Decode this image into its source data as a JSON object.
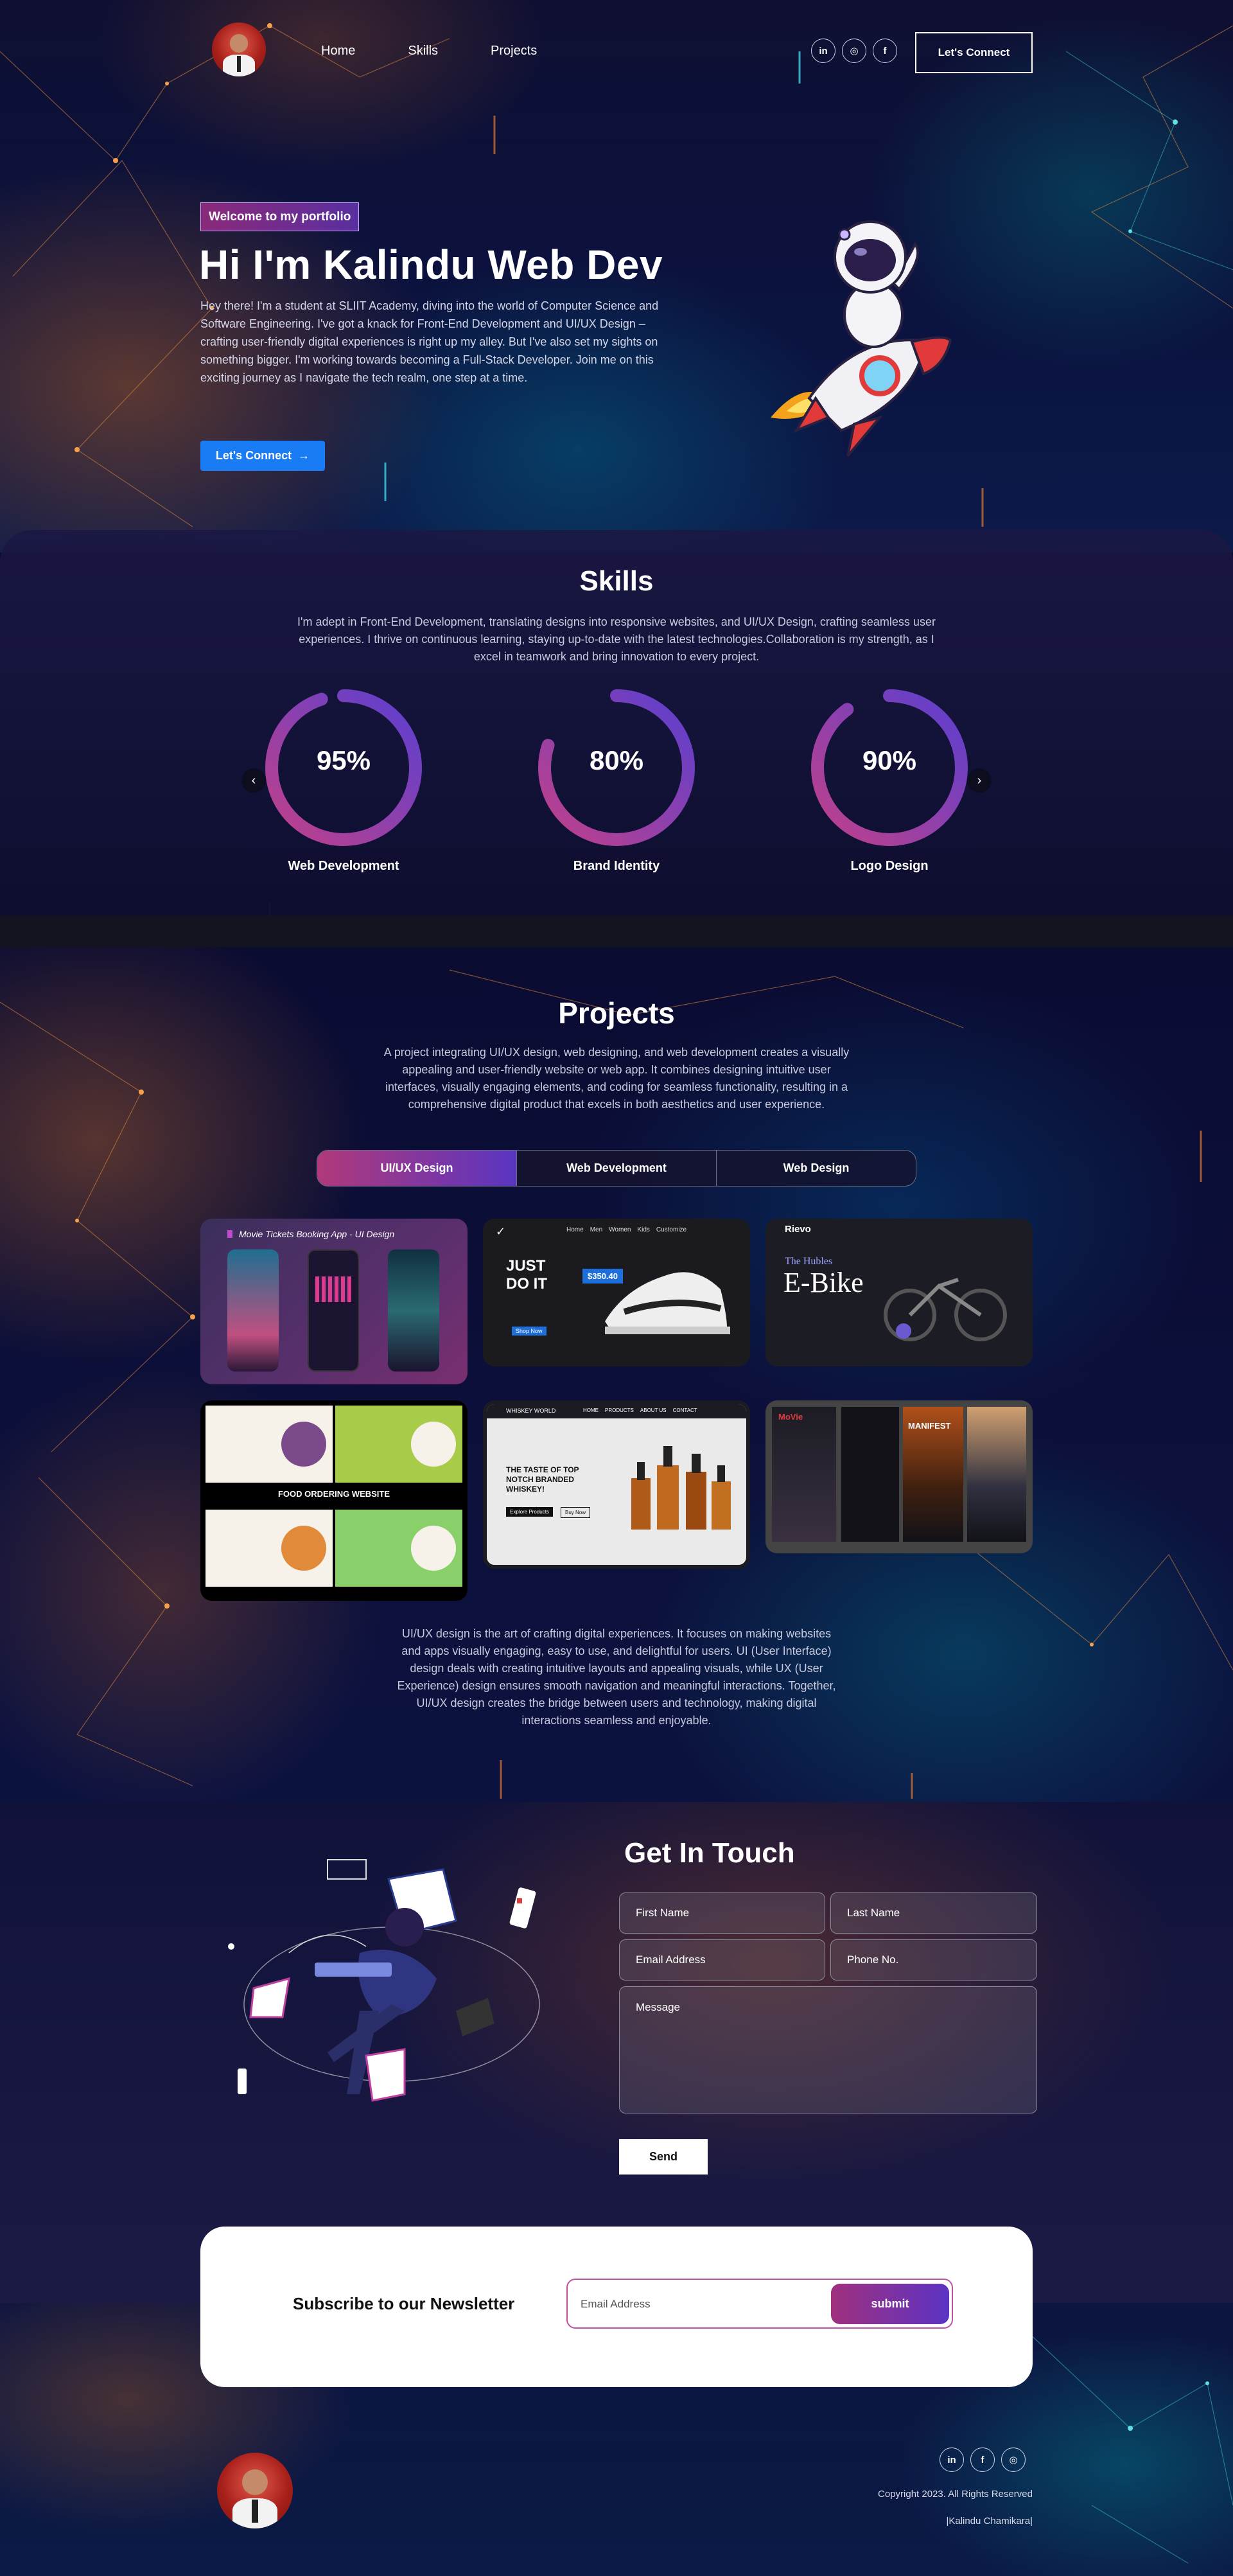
{
  "nav": {
    "links": [
      "Home",
      "Skills",
      "Projects"
    ],
    "social_icons": [
      "linkedin-icon",
      "instagram-icon",
      "facebook-icon"
    ],
    "social_glyphs": [
      "in",
      "◎",
      "f"
    ],
    "cta": "Let's Connect"
  },
  "hero": {
    "badge": "Welcome to my portfolio",
    "title": "Hi I'm Kalindu Web Dev",
    "text": "Hey there! I'm a student at SLIIT Academy, diving into the world of Computer Science and Software Engineering. I've got a knack for Front-End Development and UI/UX Design – crafting user-friendly digital experiences is right up my alley. But I've also set my sights on something bigger. I'm working towards becoming a Full-Stack Developer. Join me on this exciting journey as I navigate the tech realm, one step at a time.",
    "button": "Let's Connect"
  },
  "skills": {
    "title": "Skills",
    "text": "I'm adept in Front-End Development, translating designs into responsive websites, and UI/UX Design, crafting seamless user experiences. I thrive on continuous learning, staying up-to-date with the latest technologies.Collaboration is my strength, as I excel in teamwork and bring innovation to every project.",
    "items": [
      {
        "label": "Web Development",
        "value_text": "95%",
        "value": 95
      },
      {
        "label": "Brand Identity",
        "value_text": "80%",
        "value": 80
      },
      {
        "label": "Logo Design",
        "value_text": "90%",
        "value": 90
      }
    ]
  },
  "projects": {
    "title": "Projects",
    "text": "A project integrating UI/UX design, web designing, and web development creates a visually appealing and user-friendly website or web app. It combines designing intuitive user interfaces, visually engaging elements, and coding for seamless functionality, resulting in a comprehensive digital product that excels in both aesthetics and user experience.",
    "tabs": [
      "UI/UX Design",
      "Web Development",
      "Web Design"
    ],
    "active_tab": 0,
    "cards": {
      "movie": "Movie Tickets Booking App - UI Design",
      "nike_headline": "JUST DO IT",
      "nike_price": "$350.40",
      "nike_nav": [
        "Home",
        "Men",
        "Women",
        "Kids",
        "Customize"
      ],
      "nike_btn": "Shop Now",
      "ebike_brand": "Rievo",
      "ebike_sub": "The Hubles",
      "ebike_title": "E-Bike",
      "food_banner": "FOOD ORDERING WEBSITE",
      "whiskey_brand": "WHISKEY WORLD",
      "whiskey_nav": [
        "HOME",
        "PRODUCTS",
        "ABOUT US",
        "CONTACT"
      ],
      "whiskey_headline": "THE TASTE OF TOP NOTCH BRANDED WHISKEY!",
      "whiskey_btn1": "Explore Products",
      "whiskey_btn2": "Buy Now",
      "movie2_logo": "MoVie",
      "movie2_title": "MANIFEST"
    },
    "description": "UI/UX design is the art of crafting digital experiences. It focuses on making websites and apps visually engaging, easy to use, and delightful for users. UI (User Interface) design deals with creating intuitive layouts and appealing visuals, while UX (User Experience) design ensures smooth navigation and meaningful interactions. Together, UI/UX design creates the bridge between users and technology, making digital interactions seamless and enjoyable."
  },
  "contact": {
    "title": "Get In Touch",
    "first_name": "First Name",
    "last_name": "Last Name",
    "email": "Email Address",
    "phone": "Phone No.",
    "message": "Message",
    "send": "Send"
  },
  "newsletter": {
    "title": "Subscribe to our Newsletter",
    "placeholder": "Email Address",
    "button": "submit"
  },
  "footer": {
    "social_icons": [
      "linkedin-icon",
      "facebook-icon",
      "instagram-icon"
    ],
    "social_glyphs": [
      "in",
      "f",
      "◎"
    ],
    "copyright": "Copyright 2023. All Rights Reserved",
    "author": "|Kalindu Chamikara|"
  },
  "colors": {
    "accent_blue": "#1a7cf5",
    "gradient_start": "#b0397a",
    "gradient_end": "#5a35c0",
    "ring_gradient": [
      "#c0408a",
      "#5a3fd0"
    ]
  }
}
